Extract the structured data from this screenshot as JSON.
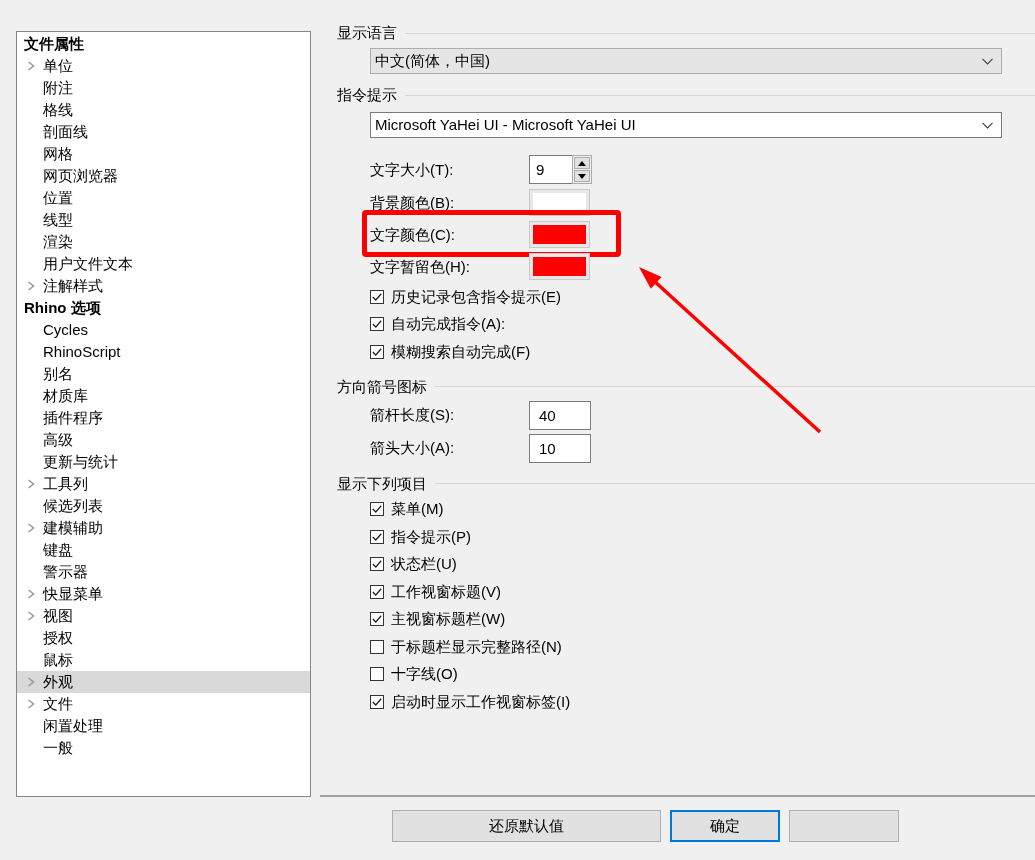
{
  "tree": [
    {
      "label": "文件属性",
      "selected": false,
      "children": [
        {
          "label": "单位",
          "expandable": true,
          "selected": false
        },
        {
          "label": "附注",
          "expandable": false,
          "selected": false
        },
        {
          "label": "格线",
          "expandable": false,
          "selected": false
        },
        {
          "label": "剖面线",
          "expandable": false,
          "selected": false
        },
        {
          "label": "网格",
          "expandable": false,
          "selected": false
        },
        {
          "label": "网页浏览器",
          "expandable": false,
          "selected": false
        },
        {
          "label": "位置",
          "expandable": false,
          "selected": false
        },
        {
          "label": "线型",
          "expandable": false,
          "selected": false
        },
        {
          "label": "渲染",
          "expandable": false,
          "selected": false
        },
        {
          "label": "用户文件文本",
          "expandable": false,
          "selected": false
        },
        {
          "label": "注解样式",
          "expandable": true,
          "selected": false
        }
      ]
    },
    {
      "label": "Rhino 选项",
      "selected": false,
      "children": [
        {
          "label": "Cycles",
          "expandable": false,
          "selected": false
        },
        {
          "label": "RhinoScript",
          "expandable": false,
          "selected": false
        },
        {
          "label": "别名",
          "expandable": false,
          "selected": false
        },
        {
          "label": "材质库",
          "expandable": false,
          "selected": false
        },
        {
          "label": "插件程序",
          "expandable": false,
          "selected": false
        },
        {
          "label": "高级",
          "expandable": false,
          "selected": false
        },
        {
          "label": "更新与统计",
          "expandable": false,
          "selected": false
        },
        {
          "label": "工具列",
          "expandable": true,
          "selected": false
        },
        {
          "label": "候选列表",
          "expandable": false,
          "selected": false
        },
        {
          "label": "建模辅助",
          "expandable": true,
          "selected": false
        },
        {
          "label": "键盘",
          "expandable": false,
          "selected": false
        },
        {
          "label": "警示器",
          "expandable": false,
          "selected": false
        },
        {
          "label": "快显菜单",
          "expandable": true,
          "selected": false
        },
        {
          "label": "视图",
          "expandable": true,
          "selected": false
        },
        {
          "label": "授权",
          "expandable": false,
          "selected": false
        },
        {
          "label": "鼠标",
          "expandable": false,
          "selected": false
        },
        {
          "label": "外观",
          "expandable": true,
          "selected": true
        },
        {
          "label": "文件",
          "expandable": true,
          "selected": false
        },
        {
          "label": "闲置处理",
          "expandable": false,
          "selected": false
        },
        {
          "label": "一般",
          "expandable": false,
          "selected": false
        }
      ]
    }
  ],
  "sections": [
    {
      "title": "显示语言",
      "controls": [
        {
          "kind": "dropdown",
          "value": "中文(简体，中国)",
          "editable": false
        }
      ]
    },
    {
      "title": "指令提示",
      "controls": [
        {
          "kind": "dropdown",
          "value": "Microsoft YaHei UI - Microsoft YaHei UI",
          "editable": true
        },
        {
          "kind": "spin",
          "label": "文字大小(T):",
          "value": "9"
        },
        {
          "kind": "color",
          "label": "背景颜色(B):",
          "color": "#ffffff",
          "highlighted": false
        },
        {
          "kind": "color",
          "label": "文字颜色(C):",
          "color": "#ff0000",
          "highlighted": true
        },
        {
          "kind": "color",
          "label": "文字暂留色(H):",
          "color": "#ff0000",
          "highlighted": false
        },
        {
          "kind": "checkbox",
          "label": "历史记录包含指令提示(E)",
          "checked": true
        },
        {
          "kind": "checkbox",
          "label": "自动完成指令(A):",
          "checked": true
        },
        {
          "kind": "checkbox",
          "label": "模糊搜索自动完成(F)",
          "checked": true
        }
      ]
    },
    {
      "title": "方向箭号图标",
      "controls": [
        {
          "kind": "number",
          "label": "箭杆长度(S):",
          "value": "40"
        },
        {
          "kind": "number",
          "label": "箭头大小(A):",
          "value": "10"
        }
      ]
    },
    {
      "title": "显示下列项目",
      "controls": [
        {
          "kind": "checkbox",
          "label": "菜单(M)",
          "checked": true
        },
        {
          "kind": "checkbox",
          "label": "指令提示(P)",
          "checked": true
        },
        {
          "kind": "checkbox",
          "label": "状态栏(U)",
          "checked": true
        },
        {
          "kind": "checkbox",
          "label": "工作视窗标题(V)",
          "checked": true
        },
        {
          "kind": "checkbox",
          "label": "主视窗标题栏(W)",
          "checked": true
        },
        {
          "kind": "checkbox",
          "label": "于标题栏显示完整路径(N)",
          "checked": false
        },
        {
          "kind": "checkbox",
          "label": "十字线(O)",
          "checked": false
        },
        {
          "kind": "checkbox",
          "label": "启动时显示工作视窗标签(I)",
          "checked": true
        }
      ]
    }
  ],
  "buttons": [
    {
      "label": "还原默认值",
      "default": false
    },
    {
      "label": "确定",
      "default": true
    },
    {
      "default": false
    }
  ]
}
